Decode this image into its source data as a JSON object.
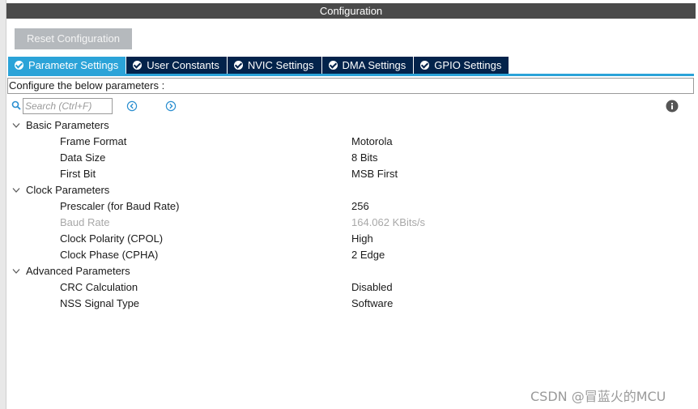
{
  "window": {
    "title": "Configuration"
  },
  "toolbar": {
    "reset_label": "Reset Configuration"
  },
  "tabs": [
    {
      "label": "Parameter Settings",
      "active": true
    },
    {
      "label": "User Constants",
      "active": false
    },
    {
      "label": "NVIC Settings",
      "active": false
    },
    {
      "label": "DMA Settings",
      "active": false
    },
    {
      "label": "GPIO Settings",
      "active": false
    }
  ],
  "description": "Configure the below parameters :",
  "search": {
    "placeholder": "Search (Ctrl+F)",
    "value": ""
  },
  "groups": [
    {
      "name": "Basic Parameters",
      "params": [
        {
          "label": "Frame Format",
          "value": "Motorola",
          "disabled": false
        },
        {
          "label": "Data Size",
          "value": "8 Bits",
          "disabled": false
        },
        {
          "label": "First Bit",
          "value": "MSB First",
          "disabled": false
        }
      ]
    },
    {
      "name": "Clock Parameters",
      "params": [
        {
          "label": "Prescaler (for Baud Rate)",
          "value": "256",
          "disabled": false
        },
        {
          "label": "Baud Rate",
          "value": "164.062 KBits/s",
          "disabled": true
        },
        {
          "label": "Clock Polarity (CPOL)",
          "value": "High",
          "disabled": false
        },
        {
          "label": "Clock Phase (CPHA)",
          "value": "2 Edge",
          "disabled": false
        }
      ]
    },
    {
      "name": "Advanced Parameters",
      "params": [
        {
          "label": "CRC Calculation",
          "value": "Disabled",
          "disabled": false
        },
        {
          "label": "NSS Signal Type",
          "value": "Software",
          "disabled": false
        }
      ]
    }
  ],
  "watermark": "CSDN @冒蓝火的MCU",
  "colors": {
    "title_bar": "#4a4a4a",
    "tab_active": "#2ba3d8",
    "tab_inactive": "#03234b",
    "reset_button": "#b5b9bd",
    "disabled_text": "#a8a8a8",
    "icon_blue": "#2b8fd0"
  },
  "icons": {
    "search": "search-icon",
    "prev": "chevron-left-circle-icon",
    "next": "chevron-right-circle-icon",
    "info": "info-icon",
    "tab_check": "check-circle-icon",
    "group_expand": "chevron-down-icon"
  }
}
